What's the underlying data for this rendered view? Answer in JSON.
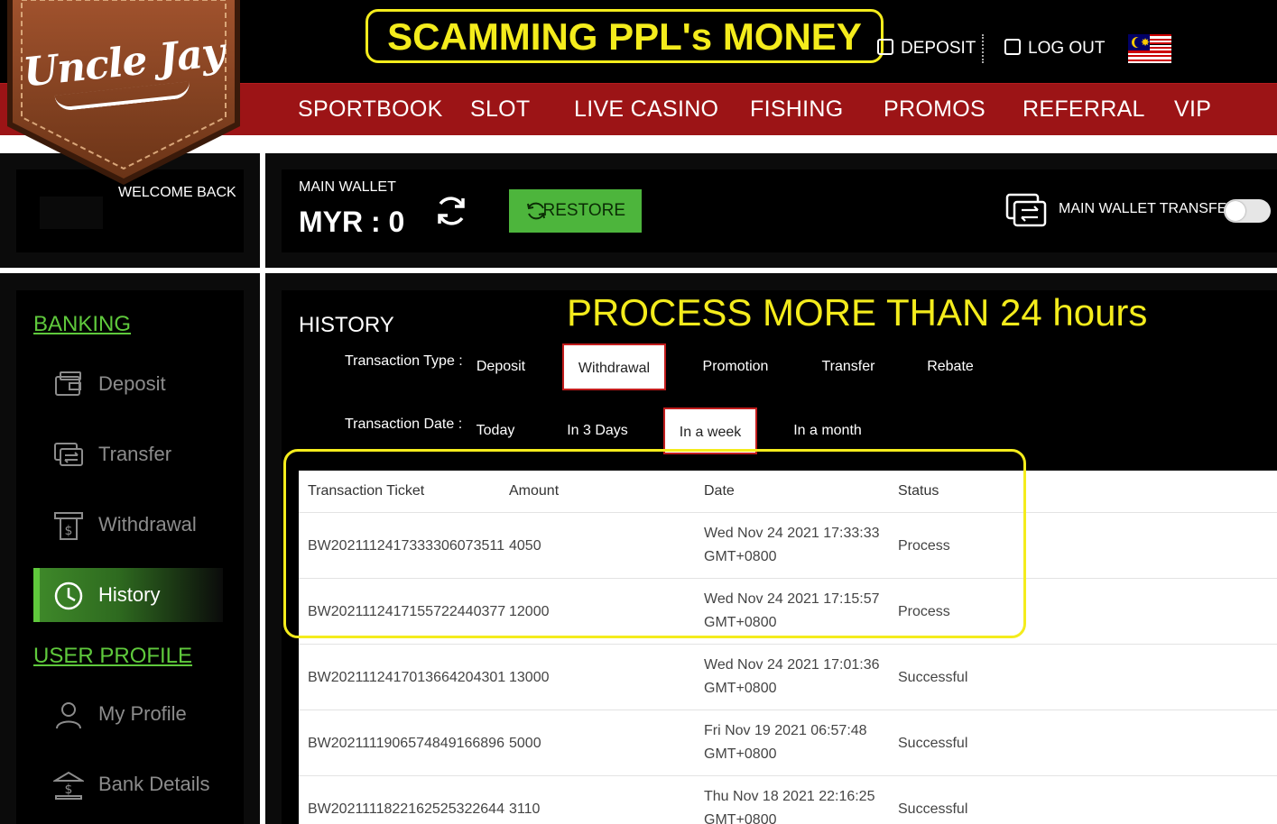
{
  "header": {
    "logo_text": "Uncle Jay",
    "annotation_top": "SCAMMING PPL's MONEY",
    "deposit_label": "DEPOSIT",
    "logout_label": "LOG OUT",
    "nav": [
      "SPORTBOOK",
      "SLOT",
      "LIVE CASINO",
      "FISHING",
      "PROMOS",
      "REFERRAL",
      "VIP"
    ]
  },
  "welcome": {
    "text": "WELCOME BACK"
  },
  "wallet": {
    "label": "MAIN WALLET",
    "amount": "MYR : 0",
    "restore_label": "RESTORE",
    "transfer_label": "MAIN WALLET TRANSFER",
    "toggle_on": false
  },
  "sidebar": {
    "banking_heading": "BANKING",
    "banking_items": [
      {
        "label": "Deposit",
        "icon": "wallet-deposit-icon"
      },
      {
        "label": "Transfer",
        "icon": "transfer-icon"
      },
      {
        "label": "Withdrawal",
        "icon": "withdrawal-icon"
      },
      {
        "label": "History",
        "icon": "clock-icon",
        "active": true
      }
    ],
    "profile_heading": "USER PROFILE",
    "profile_items": [
      {
        "label": "My Profile",
        "icon": "user-icon"
      },
      {
        "label": "Bank Details",
        "icon": "bank-icon"
      }
    ]
  },
  "history": {
    "title": "HISTORY",
    "annotation": "PROCESS MORE THAN 24 hours",
    "type_label": "Transaction Type :",
    "types": [
      "Deposit",
      "Withdrawal",
      "Promotion",
      "Transfer",
      "Rebate"
    ],
    "selected_type": "Withdrawal",
    "date_label": "Transaction Date :",
    "dates": [
      "Today",
      "In 3 Days",
      "In a week",
      "In a month"
    ],
    "selected_date": "In a week",
    "columns": [
      "Transaction Ticket",
      "Amount",
      "Date",
      "Status"
    ],
    "rows": [
      {
        "ticket": "BW2021112417333306073511",
        "amount": "4050",
        "date1": "Wed Nov 24 2021 17:33:33",
        "date2": "GMT+0800",
        "status": "Process"
      },
      {
        "ticket": "BW2021112417155722440377",
        "amount": "12000",
        "date1": "Wed Nov 24 2021 17:15:57",
        "date2": "GMT+0800",
        "status": "Process"
      },
      {
        "ticket": "BW2021112417013664204301",
        "amount": "13000",
        "date1": "Wed Nov 24 2021 17:01:36",
        "date2": "GMT+0800",
        "status": "Successful"
      },
      {
        "ticket": "BW2021111906574849166896",
        "amount": "5000",
        "date1": "Fri Nov 19 2021 06:57:48",
        "date2": "GMT+0800",
        "status": "Successful"
      },
      {
        "ticket": "BW2021111822162525322644",
        "amount": "3110",
        "date1": "Thu Nov 18 2021 22:16:25",
        "date2": "GMT+0800",
        "status": "Successful"
      }
    ]
  },
  "colors": {
    "nav_red": "#9c1416",
    "accent_green": "#4db53c",
    "annotation_yellow": "#f4ec1c",
    "selected_border": "#c21d1d"
  }
}
